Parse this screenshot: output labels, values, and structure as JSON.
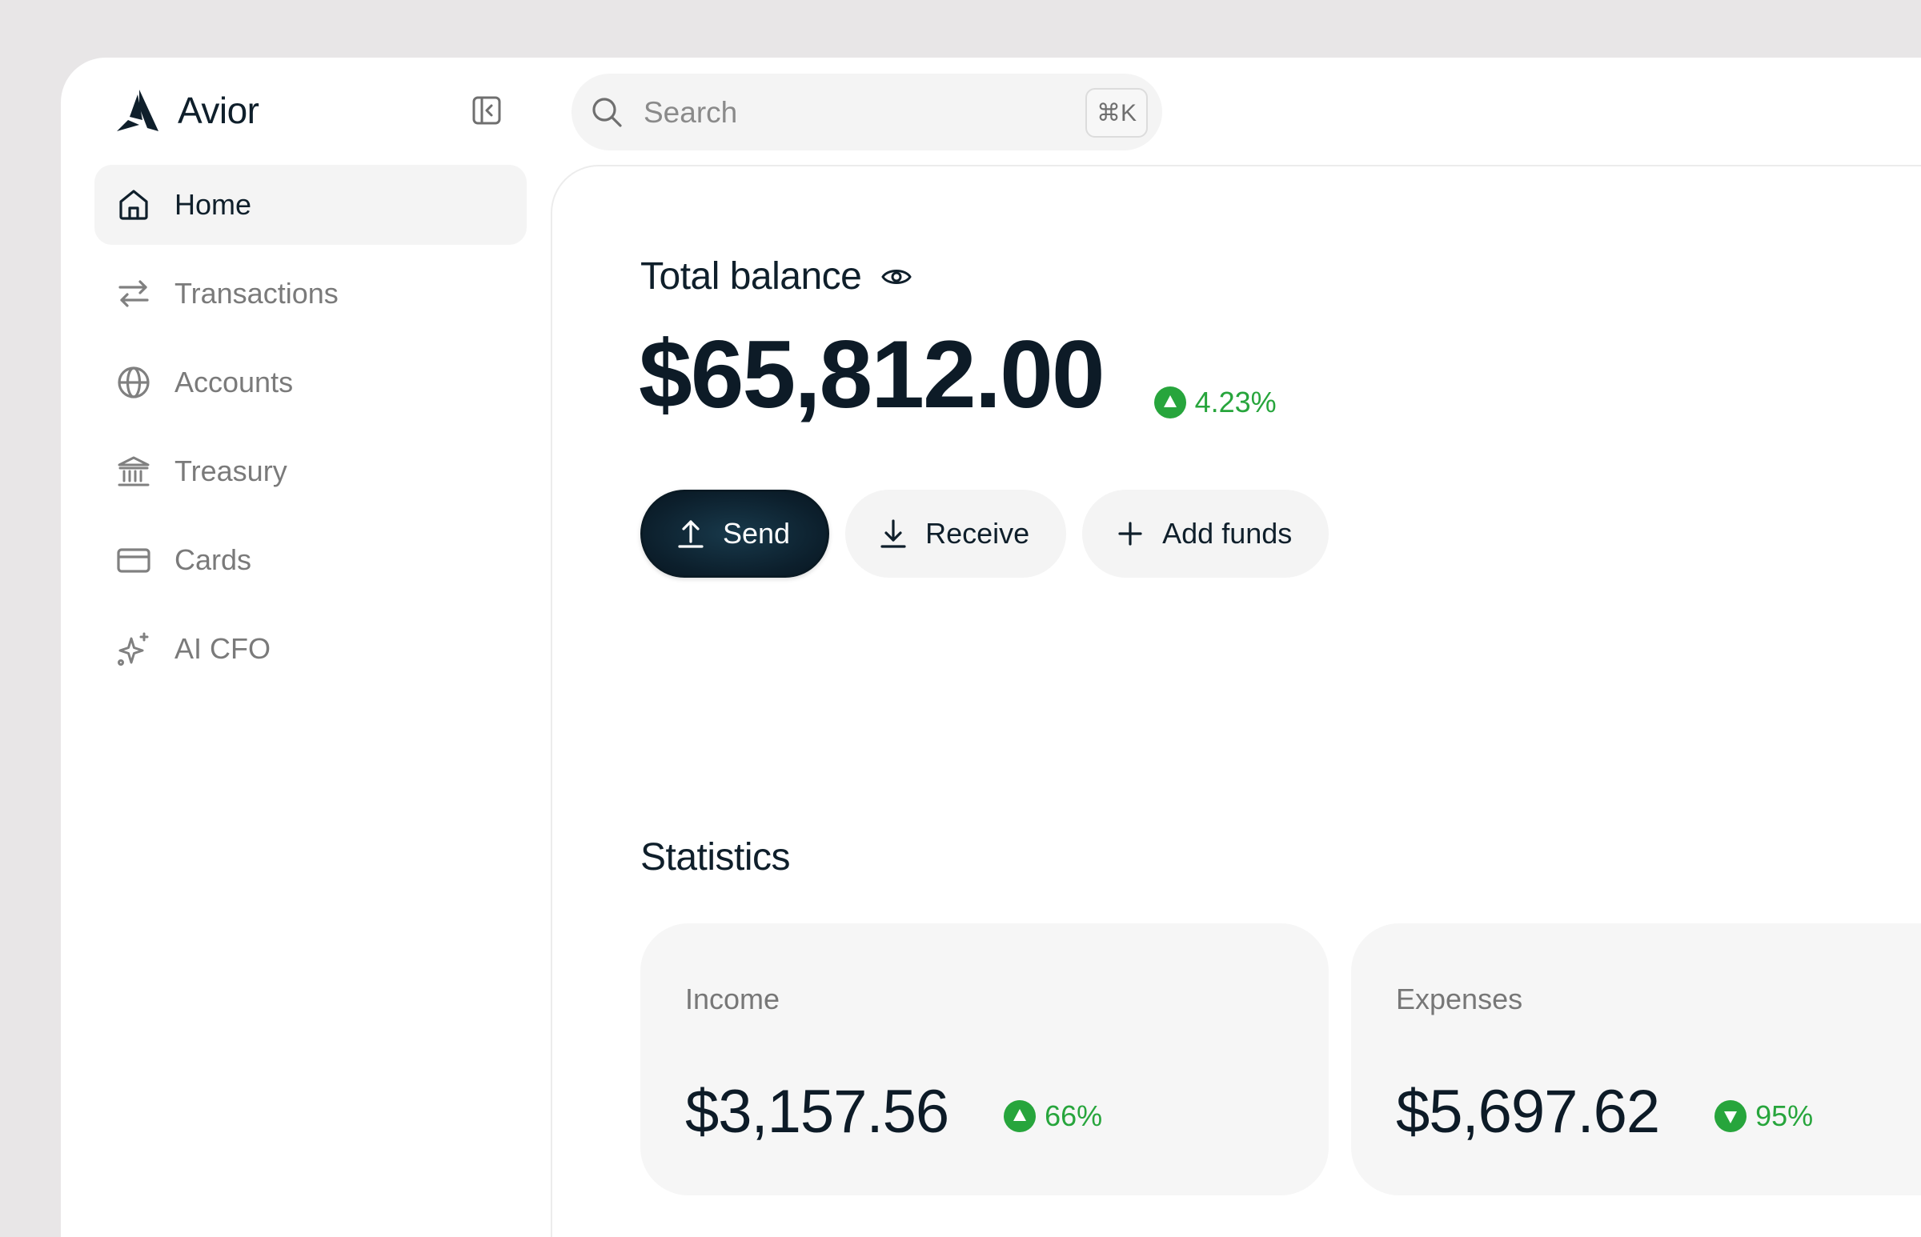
{
  "brand": {
    "name": "Avior"
  },
  "search": {
    "placeholder": "Search",
    "shortcut": "⌘K"
  },
  "sidebar": {
    "items": [
      {
        "label": "Home",
        "icon": "home-icon",
        "active": true
      },
      {
        "label": "Transactions",
        "icon": "arrows-swap-icon",
        "active": false
      },
      {
        "label": "Accounts",
        "icon": "globe-icon",
        "active": false
      },
      {
        "label": "Treasury",
        "icon": "bank-icon",
        "active": false
      },
      {
        "label": "Cards",
        "icon": "card-icon",
        "active": false
      },
      {
        "label": "AI CFO",
        "icon": "sparkle-icon",
        "active": false
      }
    ]
  },
  "balance": {
    "label": "Total balance",
    "amount": "$65,812.00",
    "change": "4.23%",
    "change_direction": "up"
  },
  "actions": {
    "send": "Send",
    "receive": "Receive",
    "add_funds": "Add funds"
  },
  "statistics": {
    "title": "Statistics",
    "income": {
      "label": "Income",
      "amount": "$3,157.56",
      "change": "66%",
      "change_direction": "up"
    },
    "expenses": {
      "label": "Expenses",
      "amount": "$5,697.62",
      "change": "95%",
      "change_direction": "down"
    }
  },
  "colors": {
    "primary": "#0c1f2c",
    "positive": "#27a53c",
    "background": "#e8e6e7",
    "surface": "#f4f4f4"
  }
}
